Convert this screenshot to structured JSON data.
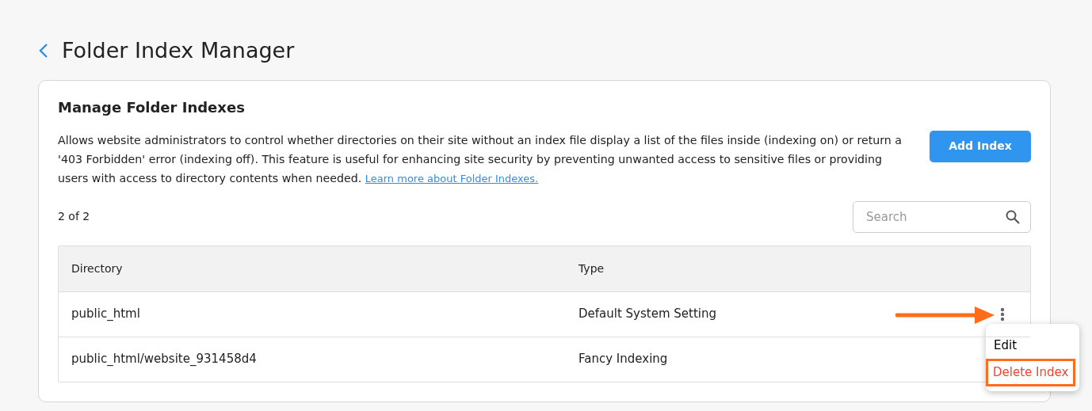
{
  "page": {
    "title": "Folder Index Manager"
  },
  "card": {
    "title": "Manage Folder Indexes",
    "description": "Allows website administrators to control whether directories on their site without an index file display a list of the files inside (indexing on) or return a '403 Forbidden' error (indexing off). This feature is useful for enhancing site security by preventing unwanted access to sensitive files or providing users with access to directory contents when needed.",
    "link": "Learn more about Folder Indexes.",
    "add_button": "Add Index",
    "count": "2 of 2",
    "search": {
      "placeholder": "Search"
    }
  },
  "table": {
    "columns": [
      "Directory",
      "Type"
    ],
    "rows": [
      {
        "cells": [
          "public_html",
          "Default System Setting"
        ],
        "menu_open": true
      },
      {
        "cells": [
          "public_html/website_931458d4",
          "Fancy Indexing"
        ],
        "menu_open": false
      }
    ]
  },
  "menu": {
    "items": [
      {
        "label": "Edit",
        "kind": "normal",
        "highlighted": false
      },
      {
        "label": "Delete Index",
        "kind": "danger",
        "highlighted": true
      }
    ]
  }
}
